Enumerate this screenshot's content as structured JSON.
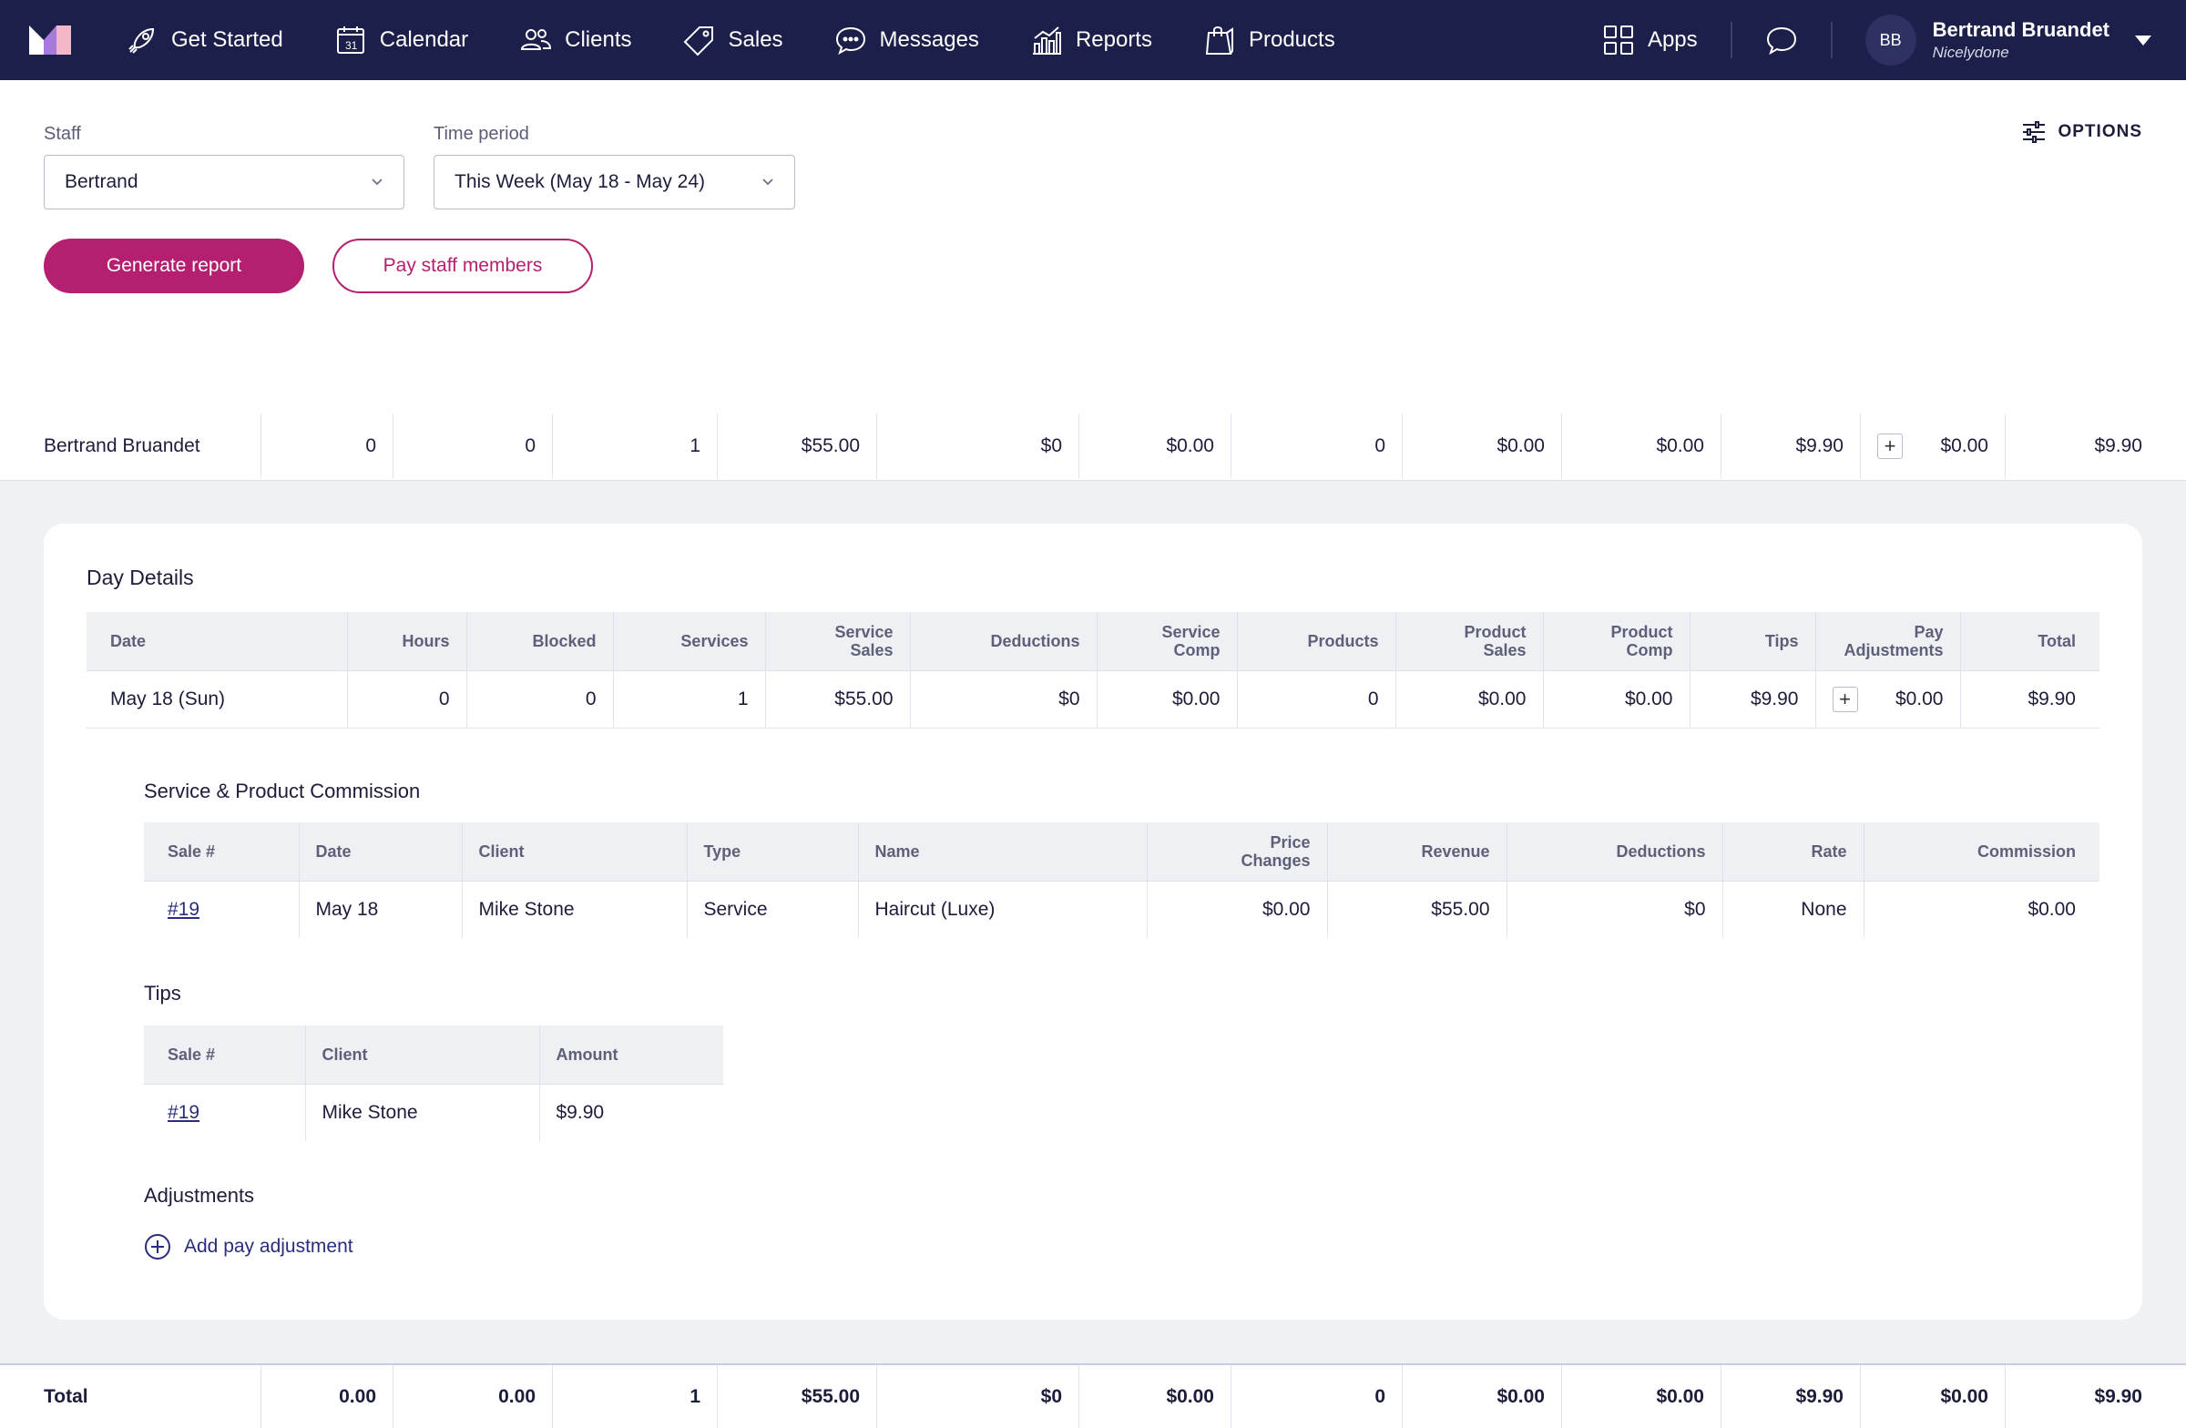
{
  "nav": {
    "items": [
      {
        "label": "Get Started",
        "icon": "rocket-icon"
      },
      {
        "label": "Calendar",
        "icon": "calendar-icon"
      },
      {
        "label": "Clients",
        "icon": "clients-icon"
      },
      {
        "label": "Sales",
        "icon": "tag-icon"
      },
      {
        "label": "Messages",
        "icon": "chat-bubble-icon"
      },
      {
        "label": "Reports",
        "icon": "bar-chart-icon"
      },
      {
        "label": "Products",
        "icon": "shopping-bag-icon"
      }
    ],
    "apps_label": "Apps",
    "avatar_initials": "BB",
    "user_name": "Bertrand Bruandet",
    "user_business": "Nicelydone"
  },
  "filters": {
    "staff_label": "Staff",
    "staff_value": "Bertrand",
    "period_label": "Time period",
    "period_value": "This Week (May 18 - May 24)",
    "options_label": "OPTIONS",
    "generate_label": "Generate report",
    "pay_label": "Pay staff members"
  },
  "summary_row": {
    "name": "Bertrand Bruandet",
    "hours": "0",
    "blocked": "0",
    "services": "1",
    "service_sales": "$55.00",
    "deductions": "$0",
    "service_comp": "$0.00",
    "products": "0",
    "product_sales": "$0.00",
    "product_comp": "$0.00",
    "tips": "$9.90",
    "pay_adjustments": "$0.00",
    "total": "$9.90"
  },
  "day_details": {
    "title": "Day Details",
    "headers": {
      "date": "Date",
      "hours": "Hours",
      "blocked": "Blocked",
      "services": "Services",
      "service_sales_1": "Service",
      "service_sales_2": "Sales",
      "deductions": "Deductions",
      "service_comp_1": "Service",
      "service_comp_2": "Comp",
      "products": "Products",
      "product_sales_1": "Product",
      "product_sales_2": "Sales",
      "product_comp_1": "Product",
      "product_comp_2": "Comp",
      "tips": "Tips",
      "pay_adj_1": "Pay",
      "pay_adj_2": "Adjustments",
      "total": "Total"
    },
    "row": {
      "date": "May 18 (Sun)",
      "hours": "0",
      "blocked": "0",
      "services": "1",
      "service_sales": "$55.00",
      "deductions": "$0",
      "service_comp": "$0.00",
      "products": "0",
      "product_sales": "$0.00",
      "product_comp": "$0.00",
      "tips": "$9.90",
      "pay_adjustments": "$0.00",
      "total": "$9.90"
    }
  },
  "commission": {
    "title": "Service & Product Commission",
    "headers": {
      "sale": "Sale #",
      "date": "Date",
      "client": "Client",
      "type": "Type",
      "name": "Name",
      "price_1": "Price",
      "price_2": "Changes",
      "revenue": "Revenue",
      "deductions": "Deductions",
      "rate": "Rate",
      "commission": "Commission"
    },
    "row": {
      "sale": "#19",
      "date": "May 18",
      "client": "Mike Stone",
      "type": "Service",
      "name": "Haircut (Luxe)",
      "price_changes": "$0.00",
      "revenue": "$55.00",
      "deductions": "$0",
      "rate": "None",
      "commission": "$0.00"
    }
  },
  "tips": {
    "title": "Tips",
    "headers": {
      "sale": "Sale #",
      "client": "Client",
      "amount": "Amount"
    },
    "row": {
      "sale": "#19",
      "client": "Mike Stone",
      "amount": "$9.90"
    }
  },
  "adjustments": {
    "title": "Adjustments",
    "add_label": "Add pay adjustment"
  },
  "total_row": {
    "name": "Total",
    "hours": "0.00",
    "blocked": "0.00",
    "services": "1",
    "service_sales": "$55.00",
    "deductions": "$0",
    "service_comp": "$0.00",
    "products": "0",
    "product_sales": "$0.00",
    "product_comp": "$0.00",
    "tips": "$9.90",
    "pay_adjustments": "$0.00",
    "total": "$9.90"
  },
  "colors": {
    "nav_bg": "#1c1f4a",
    "accent": "#b51f6f",
    "link": "#2a2d7c"
  }
}
